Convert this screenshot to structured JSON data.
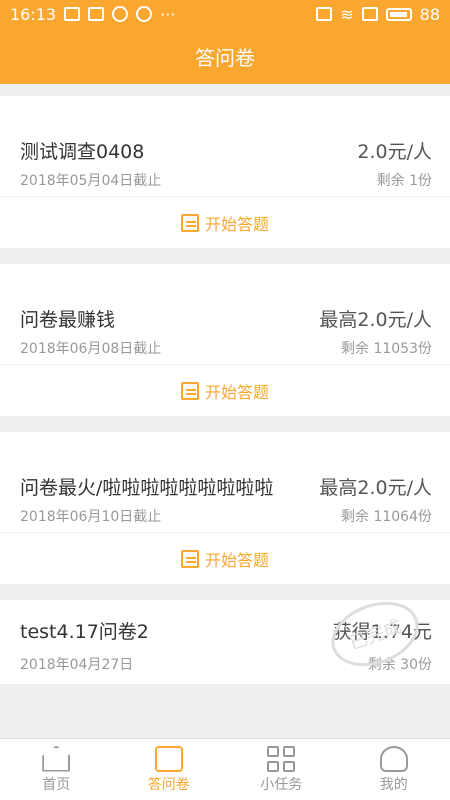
{
  "status": {
    "time": "16:13",
    "dots": "···",
    "battery": "88"
  },
  "header": {
    "title": "答问卷"
  },
  "surveys": [
    {
      "title": "测试调查0408",
      "price": "2.0元/人",
      "deadline": "2018年05月04日截止",
      "remain": "剩余 1份",
      "action": "开始答题"
    },
    {
      "title": "问卷最赚钱",
      "price": "最高2.0元/人",
      "deadline": "2018年06月08日截止",
      "remain": "剩余 11053份",
      "action": "开始答题"
    },
    {
      "title": "问卷最火/啦啦啦啦啦啦啦啦啦",
      "price": "最高2.0元/人",
      "deadline": "2018年06月10日截止",
      "remain": "剩余 11064份",
      "action": "开始答题"
    },
    {
      "title": "test4.17问卷2",
      "price": "获得1.74元",
      "deadline": "2018年04月27日",
      "remain": "剩余 30份",
      "stamp": "已完成"
    }
  ],
  "tabs": [
    {
      "label": "首页"
    },
    {
      "label": "答问卷"
    },
    {
      "label": "小任务"
    },
    {
      "label": "我的"
    }
  ]
}
